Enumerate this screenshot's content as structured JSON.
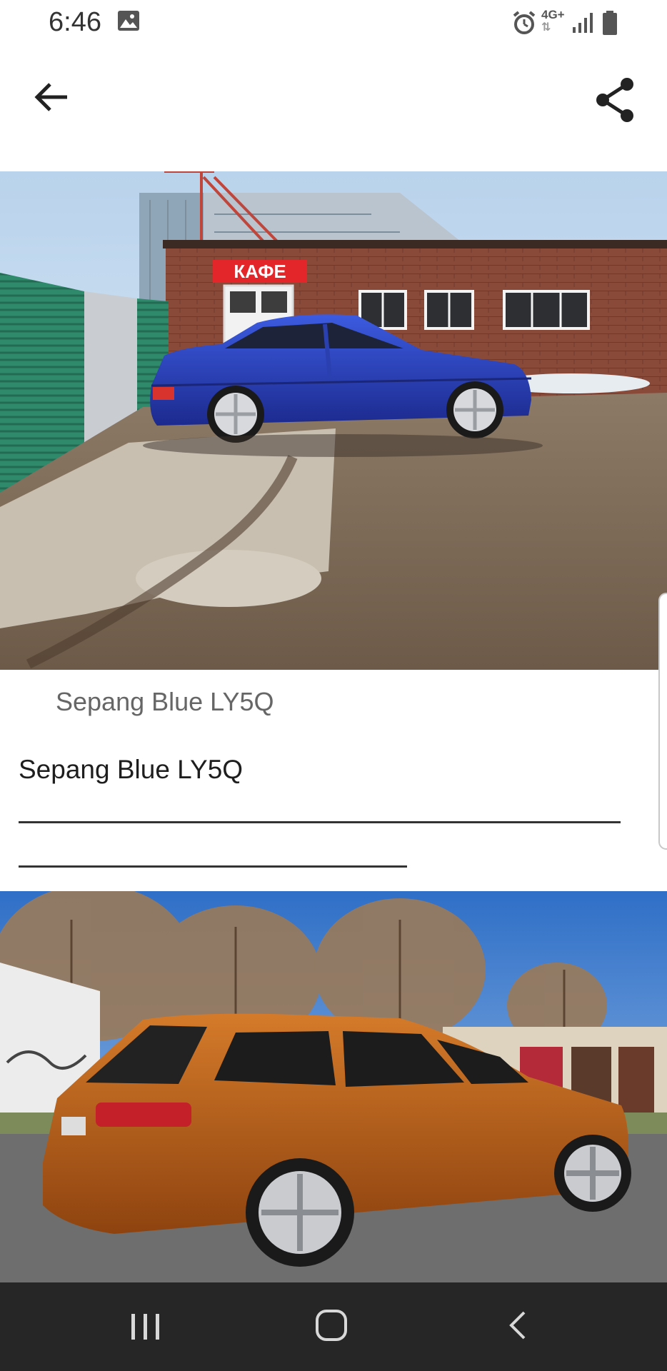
{
  "status_bar": {
    "time": "6:46",
    "network": "4G+",
    "icons": [
      "gallery-icon",
      "alarm-icon",
      "data-arrows-icon",
      "signal-icon",
      "battery-icon"
    ]
  },
  "app_bar": {
    "icons": [
      "back-arrow-icon",
      "share-icon"
    ]
  },
  "photo1": {
    "sign_text": "КАФЕ"
  },
  "content": {
    "caption_title": "Sepang Blue LY5Q",
    "body_text": "Sepang Blue LY5Q"
  },
  "nav_bar": {
    "icons": [
      "recents-icon",
      "home-icon",
      "back-icon"
    ]
  },
  "colors": {
    "nav_bar_bg": "#262626",
    "sepang_blue": "#2a3fb0",
    "orange_car": "#b35a14"
  }
}
